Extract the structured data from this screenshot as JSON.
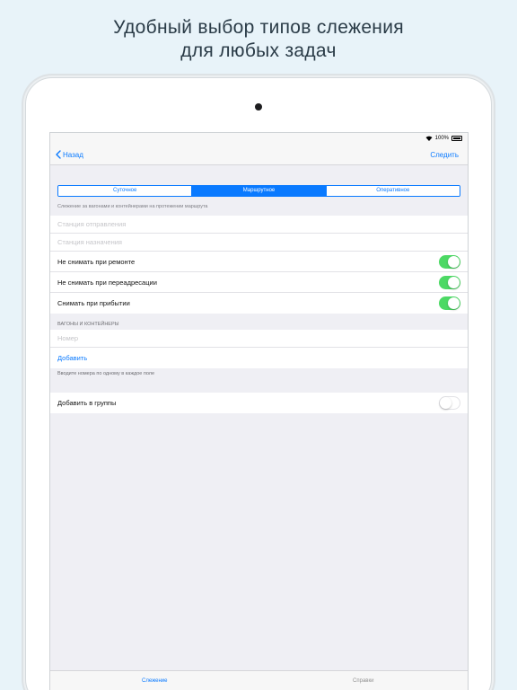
{
  "headline": {
    "line1": "Удобный выбор типов слежения",
    "line2": "для любых задач"
  },
  "status": {
    "battery": "100%"
  },
  "nav": {
    "back": "Назад",
    "action": "Следить"
  },
  "segments": [
    {
      "label": "Суточное",
      "active": false
    },
    {
      "label": "Маршрутное",
      "active": true
    },
    {
      "label": "Оперативное",
      "active": false
    }
  ],
  "hint": "Слежение за вагонами и контейнерами на протежении маршрута",
  "route": {
    "departure_placeholder": "Станция отправления",
    "destination_placeholder": "Станция назначения"
  },
  "options": [
    {
      "label": "Не снимать при ремонте",
      "on": true
    },
    {
      "label": "Не снимать при переадресации",
      "on": true
    },
    {
      "label": "Снимать при прибытии",
      "on": true
    }
  ],
  "wagons": {
    "header": "ВАГОНЫ И КОНТЕЙНЕРЫ",
    "number_placeholder": "Номер",
    "add": "Добавить",
    "note": "Вводите номера по одному в каждое поле"
  },
  "groups": {
    "label": "Добавить в группы",
    "on": false
  },
  "tabs": [
    {
      "label": "Слежение",
      "active": true
    },
    {
      "label": "Справки",
      "active": false
    }
  ],
  "colors": {
    "accent": "#0a7aff",
    "switch_on": "#4cd964",
    "background": "#e8f3f9"
  }
}
